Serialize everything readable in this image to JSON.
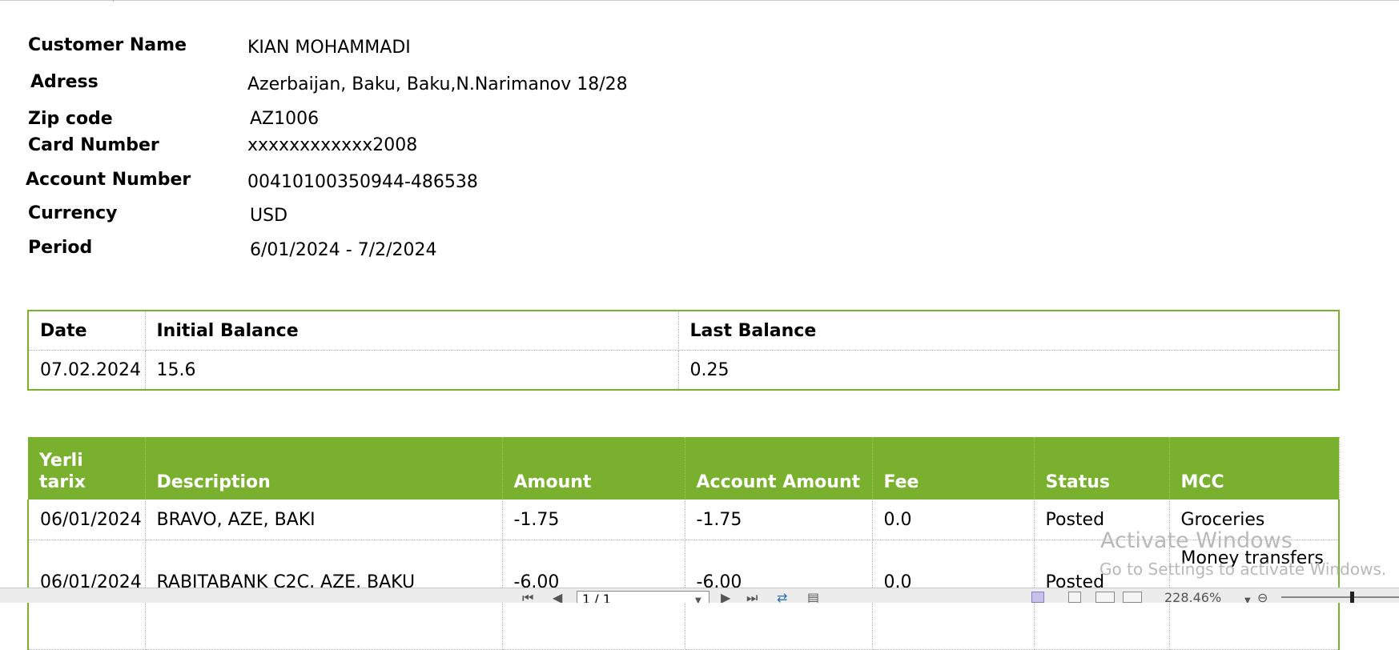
{
  "customer": {
    "name_label": "Customer Name",
    "name_value": "KIAN MOHAMMADI",
    "address_label": "Adress",
    "address_value": "Azerbaijan, Baku, Baku,N.Narimanov 18/28",
    "zip_label": "Zip code",
    "zip_value": "AZ1006",
    "card_label": "Card Number",
    "card_value": "xxxxxxxxxxxx2008",
    "account_label": "Account Number",
    "account_value": "00410100350944-486538",
    "currency_label": "Currency",
    "currency_value": "USD",
    "period_label": "Period",
    "period_value": "6/01/2024 - 7/2/2024"
  },
  "balance_table": {
    "headers": [
      "Date",
      "Initial Balance",
      "Last Balance"
    ],
    "row": [
      "07.02.2024",
      "15.6",
      "0.25"
    ]
  },
  "transactions": {
    "headers": [
      "Yerli tarix",
      "Description",
      "Amount",
      "Account Amount",
      "Fee",
      "Status",
      "MCC"
    ],
    "rows": [
      [
        "06/01/2024",
        "BRAVO, AZE, BAKI",
        "-1.75",
        "-1.75",
        "0.0",
        "Posted",
        "Groceries"
      ],
      [
        "06/01/2024",
        "RABITABANK C2C, AZE, BAKU",
        "-6.00",
        "-6.00",
        "0.0",
        "Posted",
        "Money transfers"
      ]
    ]
  },
  "watermark": {
    "line1": "Activate Windows",
    "line2": "Go to Settings to activate Windows."
  },
  "statusbar": {
    "page": "1 / 1",
    "zoom": "228.46%"
  },
  "colors": {
    "accent_green": "#79b12e",
    "watermark": "#b9b9b9"
  }
}
